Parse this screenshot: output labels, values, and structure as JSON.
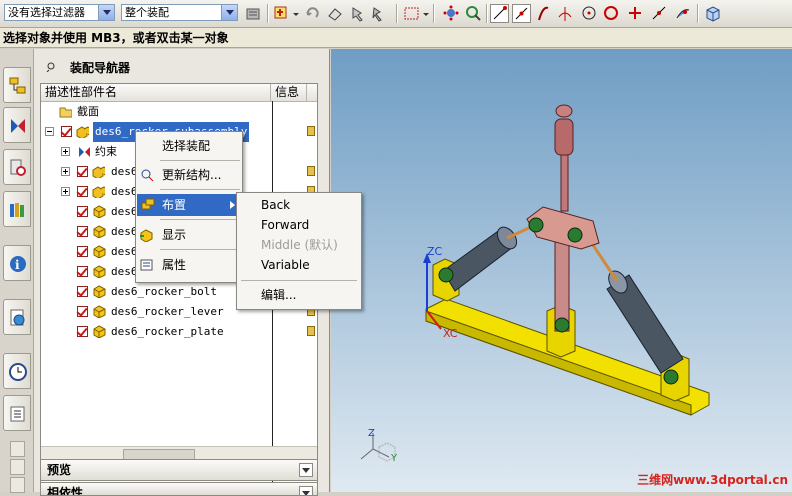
{
  "toolbar": {
    "filter_combo": "没有选择过滤器",
    "scope_combo": "整个装配"
  },
  "status": {
    "prompt": "选择对象并使用 MB3，或者双击某一对象"
  },
  "navigator": {
    "title": "装配导航器",
    "columns": [
      "描述性部件名",
      "信息"
    ],
    "rows": [
      {
        "label": "截面",
        "kind": "folder"
      },
      {
        "label": "des6_rocker_subassembly",
        "kind": "assembly",
        "selected": true
      },
      {
        "label": "约束",
        "kind": "constraint"
      },
      {
        "label": "des6_...",
        "kind": "part"
      },
      {
        "label": "des6_...",
        "kind": "part"
      },
      {
        "label": "des6_...",
        "kind": "part"
      },
      {
        "label": "des6_...",
        "kind": "part"
      },
      {
        "label": "des6_...",
        "kind": "part"
      },
      {
        "label": "des6_rocker_bolt",
        "kind": "part"
      },
      {
        "label": "des6_rocker_lever",
        "kind": "part"
      },
      {
        "label": "des6_rocker_plate",
        "kind": "part"
      }
    ],
    "panels": [
      "预览",
      "相依性"
    ]
  },
  "context_menu": {
    "items": [
      "选择装配",
      "更新结构...",
      "布置",
      "显示",
      "属性"
    ]
  },
  "submenu": {
    "items": [
      "Back",
      "Forward",
      "Middle (默认)",
      "Variable",
      "编辑..."
    ]
  },
  "viewport": {
    "axis_x": "XC",
    "axis_z": "ZC",
    "triad_z": "Z",
    "triad_y": "Y",
    "watermark": "三维网www.3dportal.cn"
  },
  "colors": {
    "selection": "#316ac5",
    "base_plate": "#f2e100",
    "brackets": "#e8d500",
    "lever": "#c98a8a",
    "cylinder": "#5a6675"
  }
}
